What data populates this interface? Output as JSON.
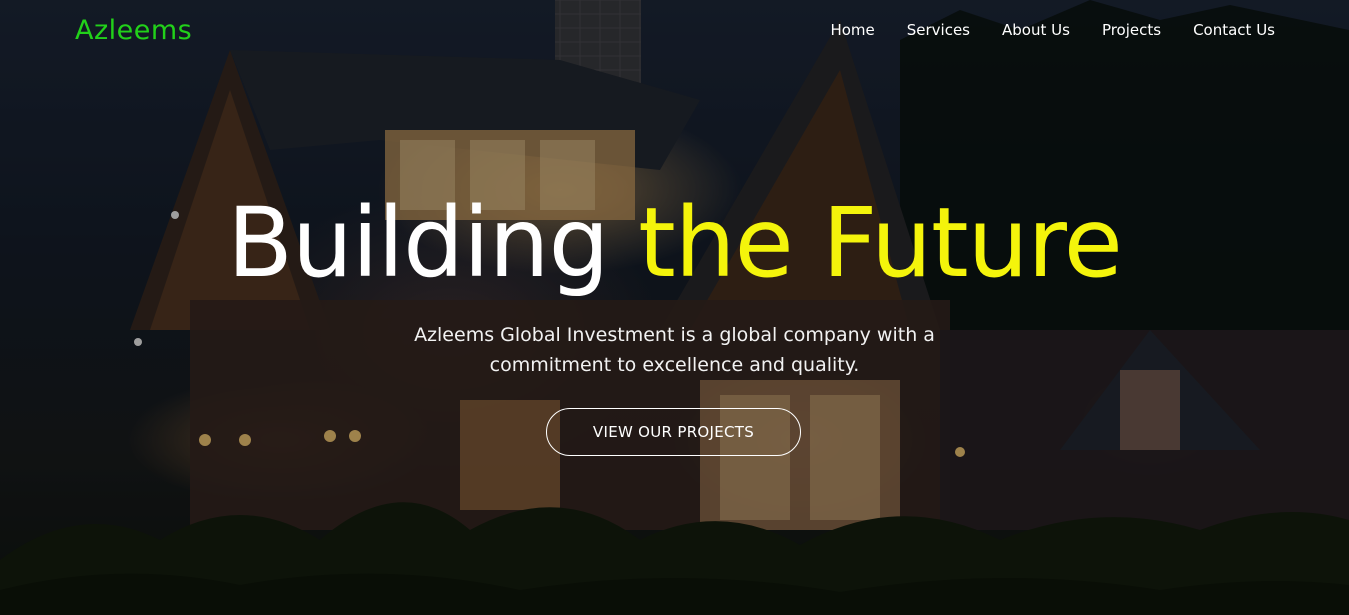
{
  "brand": {
    "logo_text": "Azleems",
    "logo_color": "#22d11a"
  },
  "nav": {
    "items": [
      {
        "label": "Home"
      },
      {
        "label": "Services"
      },
      {
        "label": "About Us"
      },
      {
        "label": "Projects"
      },
      {
        "label": "Contact Us"
      }
    ]
  },
  "hero": {
    "headline_white": "Building",
    "headline_yellow": "the Future",
    "headline_accent_color": "#f4f40b",
    "subtitle_line1": "Azleems Global Investment is a global company with a",
    "subtitle_line2": "commitment to excellence and quality.",
    "cta_label": "VIEW OUR PROJECTS",
    "background_image": "house-at-night-photo"
  }
}
